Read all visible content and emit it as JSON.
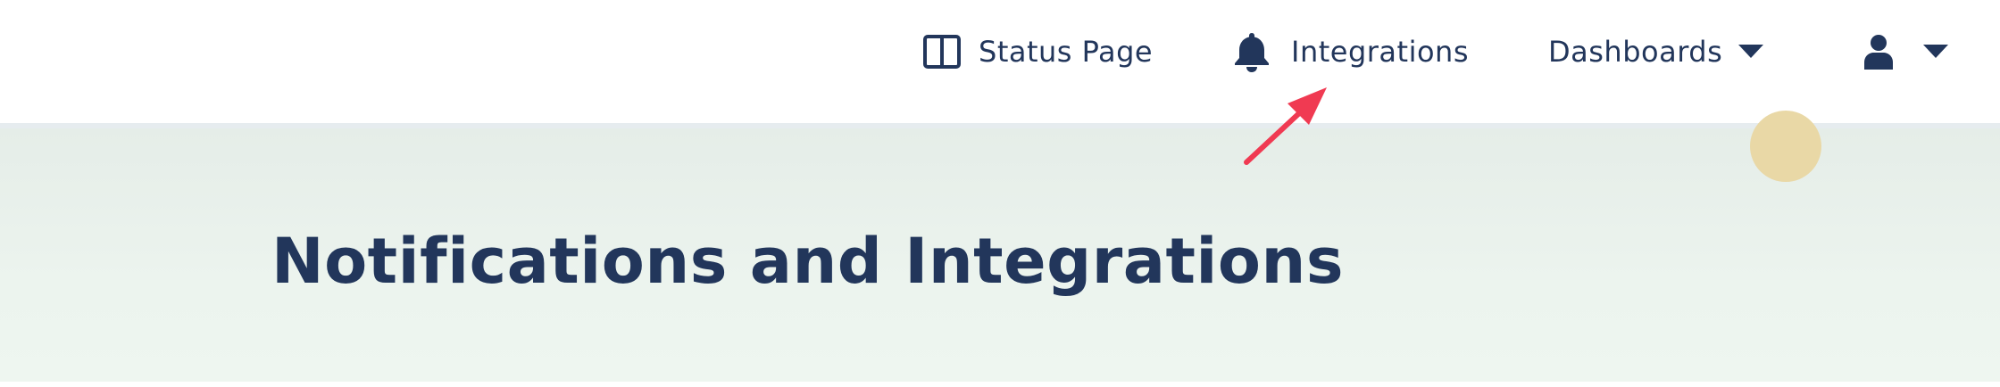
{
  "nav": {
    "status_page": {
      "label": "Status Page",
      "icon": "columns-icon"
    },
    "integrations": {
      "label": "Integrations",
      "icon": "bell-icon"
    },
    "dashboards": {
      "label": "Dashboards",
      "icon": "caret-down-icon"
    },
    "user": {
      "icon": "user-icon",
      "menu_icon": "caret-down-icon"
    }
  },
  "hero": {
    "title": "Notifications and Integrations"
  },
  "annotation": {
    "arrow_color": "#f03a52"
  },
  "colors": {
    "text": "#22365b",
    "hero_background": "#ecf4ee",
    "decor_circle": "#e9d8a6"
  }
}
